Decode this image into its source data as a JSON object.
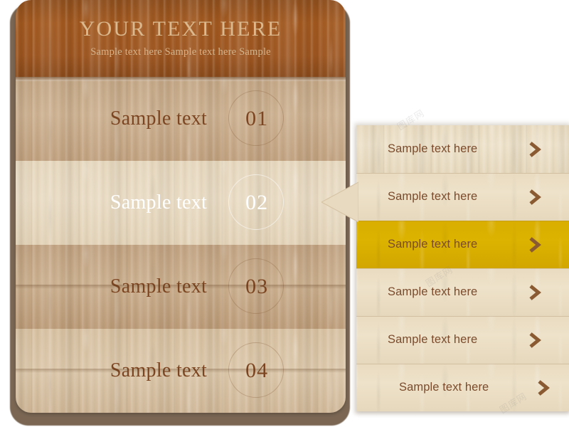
{
  "header": {
    "title": "YOUR TEXT HERE",
    "subtitle": "Sample text here  Sample text here Sample"
  },
  "main_menu": {
    "rows": [
      {
        "label": "Sample text",
        "number": "01",
        "state": "normal"
      },
      {
        "label": "Sample text",
        "number": "02",
        "state": "active"
      },
      {
        "label": "Sample text",
        "number": "03",
        "state": "normal"
      },
      {
        "label": "Sample text",
        "number": "04",
        "state": "normal"
      }
    ]
  },
  "submenu": {
    "items": [
      {
        "label": "Sample text here",
        "icon": "chevron-right-icon",
        "state": "normal"
      },
      {
        "label": "Sample text here",
        "icon": "chevron-right-icon",
        "state": "normal"
      },
      {
        "label": "Sample text here",
        "icon": "chevron-right-icon",
        "state": "active"
      },
      {
        "label": "Sample text here",
        "icon": "chevron-right-icon",
        "state": "normal"
      },
      {
        "label": "Sample text here",
        "icon": "chevron-right-icon",
        "state": "normal"
      },
      {
        "label": "Sample text here",
        "icon": "chevron-right-icon",
        "state": "normal"
      }
    ]
  },
  "watermarks": {
    "text_1": "图库网",
    "text_2": "图库网",
    "text_3": "图库网"
  },
  "colors": {
    "header_wood": "#9e5620",
    "row_dark": "#c3a684",
    "row_active": "#e8d9bf",
    "row_mid": "#c0a17f",
    "row_light": "#d7c0a0",
    "panel_frame": "#6f5a45",
    "submenu_bg": "#e9dbc0",
    "submenu_active": "#d9ae00",
    "text_brown": "#7d4622",
    "text_active": "#ffffff",
    "header_title": "#dbb98f"
  }
}
